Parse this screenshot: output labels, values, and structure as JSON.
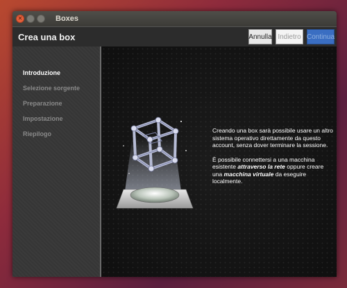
{
  "window": {
    "title": "Boxes",
    "controls": [
      "close-icon",
      "minimize-icon",
      "maximize-icon"
    ]
  },
  "header": {
    "title": "Crea una box",
    "buttons": {
      "cancel": "Annulla",
      "back": "Indietro",
      "next": "Continua"
    }
  },
  "sidebar": {
    "items": [
      {
        "label": "Introduzione",
        "active": true
      },
      {
        "label": "Selezione sorgente",
        "active": false
      },
      {
        "label": "Preparazione",
        "active": false
      },
      {
        "label": "Impostazione",
        "active": false
      },
      {
        "label": "Riepilogo",
        "active": false
      }
    ]
  },
  "main": {
    "paragraph1": "Creando una box sarà possibile usare un altro sistema operativo direttamente da questo account, senza dover terminare la sessione.",
    "p2_before": "È possibile connettersi a una macchina esistente ",
    "p2_link1": "attraverso la rete",
    "p2_mid": " oppure creare una ",
    "p2_link2": "macchina virtuale",
    "p2_after": " da eseguire localmente."
  },
  "colors": {
    "accent": "#3a6ec2",
    "close_button": "#e5603a"
  }
}
